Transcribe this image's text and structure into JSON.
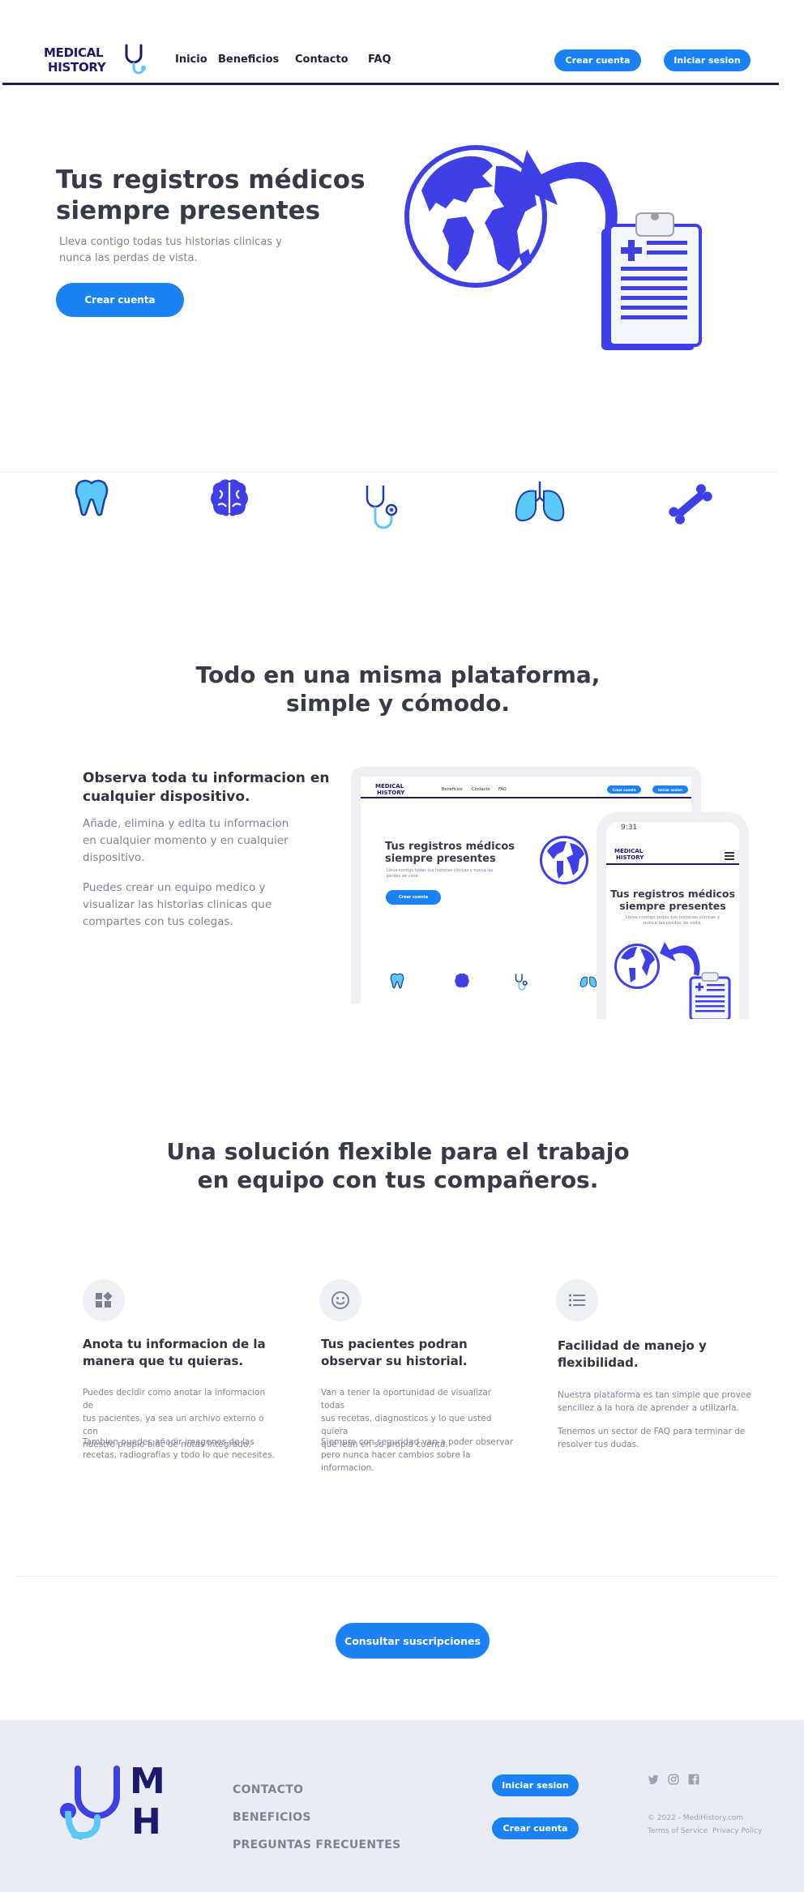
{
  "header": {
    "logo_line1": "MEDICAL",
    "logo_line2": "HISTORY",
    "nav": [
      "Inicio",
      "Beneficios",
      "Contacto",
      "FAQ"
    ],
    "create_account": "Crear cuenta",
    "login": "Iniciar sesion"
  },
  "hero": {
    "title_line1": "Tus registros médicos",
    "title_line2": "siempre presentes",
    "subtitle_line1": "Lleva contigo todas tus historias clinicas y",
    "subtitle_line2": "nunca las perdas de vista.",
    "cta": "Crear cuenta"
  },
  "icons_row": [
    "tooth-icon",
    "brain-icon",
    "stethoscope-icon",
    "lungs-icon",
    "bone-icon"
  ],
  "platform": {
    "title_line1": "Todo en una misma plataforma,",
    "title_line2": "simple y cómodo.",
    "heading_line1": "Observa toda tu informacion en",
    "heading_line2": "cualquier dispositivo.",
    "p1_line1": "Añade, elimina y edita tu informacion",
    "p1_line2": "en cualquier momento y en cualquier",
    "p1_line3": "dispositivo.",
    "p2_line1": "Puedes crear un equipo medico y",
    "p2_line2": "visualizar las historias clinicas que",
    "p2_line3": "compartes con tus colegas."
  },
  "mockup": {
    "logo_line1": "MEDICAL",
    "logo_line2": "HISTORY",
    "nav": [
      "Beneficios",
      "Contacto",
      "FAQ"
    ],
    "create": "Crear cuenta",
    "login": "Iniciar sesion",
    "title_line1": "Tus registros médicos",
    "title_line2": "siempre presentes",
    "sub_line1": "Lleva contigo todas tus historias clinicas y nunca las",
    "sub_line2": "perdas de vista.",
    "cta": "Crear cuenta",
    "phone_time": "9:31",
    "phone_title_line1": "Tus registros médicos",
    "phone_title_line2": "siempre presentes",
    "phone_sub_line1": "Lleva contigo todas tus historias clinicas y",
    "phone_sub_line2": "nunca las perdas de vista."
  },
  "teamwork": {
    "title_line1": "Una solución flexible para el trabajo",
    "title_line2": "en equipo con tus compañeros."
  },
  "features": [
    {
      "icon": "widgets-icon",
      "title_line1": "Anota tu informacion de la",
      "title_line2": "manera que tu quieras.",
      "p1": [
        "Puedes decidir como anotar la informacion de",
        "tus pacientes, ya sea un archivo externo o con",
        "nuestro propio bloc de notas integrado,"
      ],
      "p2": [
        "Tambien puedes añadir imagenes de las",
        "recetas, radiografías y todo lo que necesites."
      ]
    },
    {
      "icon": "smiley-icon",
      "title_line1": "Tus pacientes podran",
      "title_line2": "observar su historial.",
      "p1": [
        "Van a tener la oportunidad de visualizar todas",
        "sus recetas, diagnosticos y lo que usted quiera",
        "que lean en su propia cuenta."
      ],
      "p2": [
        "Siempre con seguridad  van a poder observar",
        "pero nunca hacer cambios sobre la",
        "informacion."
      ]
    },
    {
      "icon": "list-icon",
      "title_line1": "Facilidad de manejo y",
      "title_line2": "flexibilidad.",
      "p1": [
        "Nuestra plataforma es tan simple que provee",
        "sencillez a la hora de aprender a utilizarla."
      ],
      "p2": [
        "Tenemos un sector de FAQ para terminar de",
        "resolver tus dudas."
      ]
    }
  ],
  "subscriptions_cta": "Consultar suscripciones",
  "footer": {
    "logo_m": "M",
    "logo_h": "H",
    "links": [
      "CONTACTO",
      "BENEFICIOS",
      "PREGUNTAS FRECUENTES"
    ],
    "login": "Iniciar sesion",
    "create": "Crear cuenta",
    "social": [
      "twitter-icon",
      "instagram-icon",
      "facebook-icon"
    ],
    "copyright": "© 2022 - MediHistory.com",
    "terms": "Terms of Service",
    "privacy": "Privacy Policy"
  },
  "colors": {
    "primary_button": "#1a82f5",
    "illustration_blue": "#3f3fe8",
    "navy": "#1c1a6b",
    "light_blue": "#5bc8f5",
    "footer_bg": "#e9edf3"
  }
}
